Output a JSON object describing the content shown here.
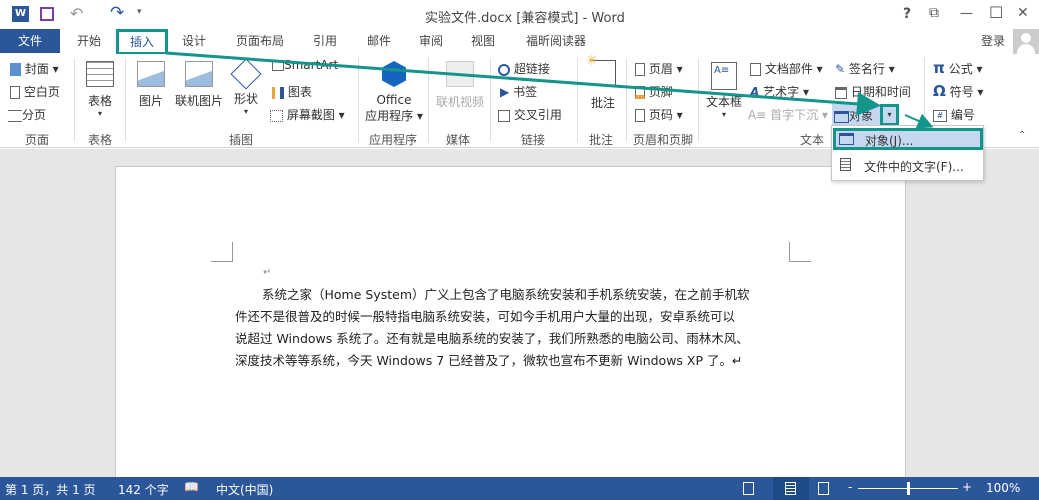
{
  "title": "实验文件.docx [兼容模式] - Word",
  "window_buttons": {
    "help": "?",
    "ribbon_display": "⧉",
    "minimize": "—",
    "maximize": "☐",
    "close": "✕"
  },
  "tabs": [
    "文件",
    "开始",
    "插入",
    "设计",
    "页面布局",
    "引用",
    "邮件",
    "审阅",
    "视图",
    "福昕阅读器"
  ],
  "active_tab": "插入",
  "signin": "登录",
  "ribbon": {
    "pages": {
      "label": "页面",
      "cover": "封面",
      "blank": "空白页",
      "break": "分页"
    },
    "tables": {
      "label": "表格",
      "table": "表格"
    },
    "illustrations": {
      "label": "插图",
      "pictures": "图片",
      "online_pictures": "联机图片",
      "shapes": "形状",
      "smartart": "SmartArt",
      "chart": "图表",
      "screenshot": "屏幕截图"
    },
    "apps": {
      "label": "应用程序",
      "office_line1": "Office",
      "office_line2": "应用程序"
    },
    "media": {
      "label": "媒体",
      "online_video": "联机视频"
    },
    "links": {
      "label": "链接",
      "hyperlink": "超链接",
      "bookmark": "书签",
      "crossref": "交叉引用"
    },
    "comments": {
      "label": "批注",
      "comment": "批注"
    },
    "header_footer": {
      "label": "页眉和页脚",
      "header": "页眉",
      "footer": "页脚",
      "page_number": "页码"
    },
    "text": {
      "label": "文本",
      "textbox": "文本框",
      "quick_parts": "文档部件",
      "wordart": "艺术字",
      "dropcap": "首字下沉",
      "signature": "签名行",
      "datetime": "日期和时间",
      "object": "对象"
    },
    "symbols": {
      "equation": "公式",
      "symbol": "符号",
      "numbering": "编号"
    }
  },
  "object_menu": {
    "items": [
      "对象(J)...",
      "文件中的文字(F)..."
    ]
  },
  "document": {
    "lines": [
      "系统之家（Home System）广义上包含了电脑系统安装和手机系统安装，在之前手机软",
      "件还不是很普及的时候一般特指电脑系统安装，可如今手机用户大量的出现，安卓系统可以",
      "说超过 Windows 系统了。还有就是电脑系统的安装了，我们所熟悉的电脑公司、雨林木风、",
      "深度技术等等系统，今天 Windows 7 已经普及了，微软也宣布不更新 Windows XP 了。↵"
    ]
  },
  "status": {
    "page": "第 1 页，共 1 页",
    "words": "142 个字",
    "language": "中文(中国)",
    "zoom": "100%",
    "zoom_level": 100
  },
  "colors": {
    "word_blue": "#2b579a",
    "highlight": "#13958c"
  }
}
